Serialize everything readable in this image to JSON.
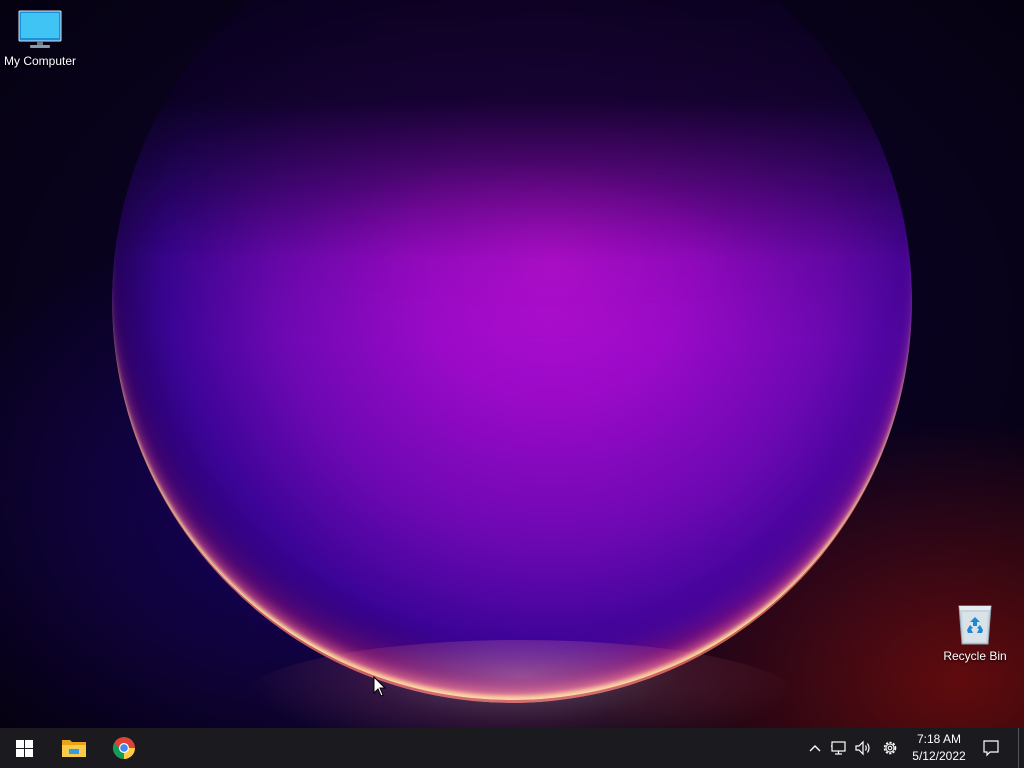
{
  "desktop": {
    "icons": [
      {
        "label": "My Computer",
        "icon": "monitor-icon"
      },
      {
        "label": "Recycle Bin",
        "icon": "recycle-bin-icon"
      }
    ]
  },
  "taskbar": {
    "pinned": [
      {
        "name": "Start",
        "icon": "windows-logo-icon"
      },
      {
        "name": "File Explorer",
        "icon": "folder-icon"
      },
      {
        "name": "Google Chrome",
        "icon": "chrome-icon"
      }
    ],
    "tray": {
      "icons": [
        "chevron-up-icon",
        "network-icon",
        "volume-icon",
        "settings-gear-icon"
      ],
      "time": "7:18 AM",
      "date": "5/12/2022",
      "notification_icon": "notification-icon"
    }
  },
  "colors": {
    "taskbar_bg": "#1b1b1f",
    "accent_blue": "#2f9ee6",
    "wallpaper_purple": "#a60ccb"
  }
}
